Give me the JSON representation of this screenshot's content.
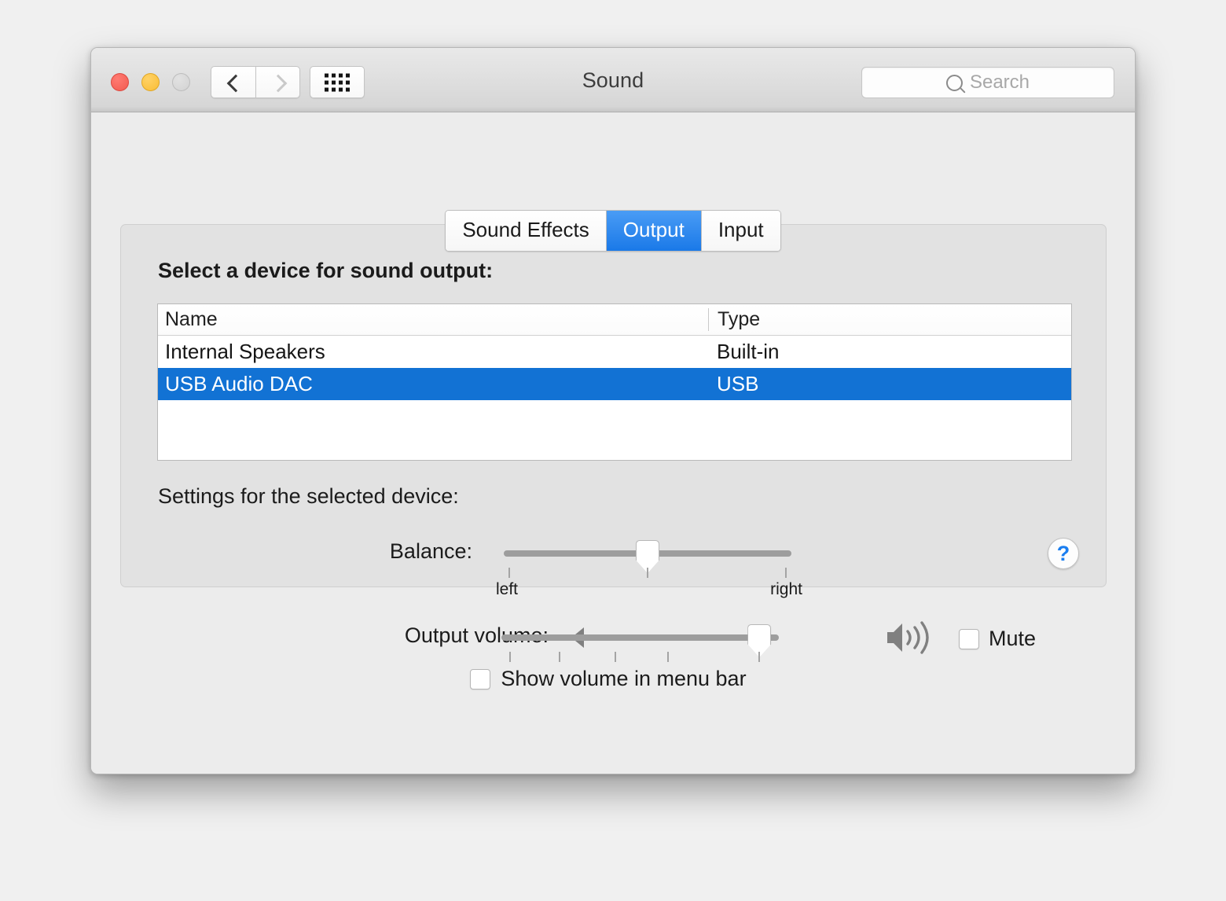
{
  "window": {
    "title": "Sound",
    "traffic_lights": [
      "close",
      "minimize",
      "zoom"
    ],
    "nav": {
      "back": "back",
      "forward": "forward",
      "show_all": "show-all"
    },
    "search": {
      "placeholder": "Search",
      "value": ""
    }
  },
  "tabs": [
    {
      "label": "Sound Effects",
      "active": false
    },
    {
      "label": "Output",
      "active": true
    },
    {
      "label": "Input",
      "active": false
    }
  ],
  "panel": {
    "select_device_label": "Select a device for sound output:",
    "settings_label": "Settings for the selected device:",
    "help_label": "?"
  },
  "device_table": {
    "columns": [
      "Name",
      "Type"
    ],
    "rows": [
      {
        "name": "Internal Speakers",
        "type": "Built-in",
        "selected": false
      },
      {
        "name": "USB Audio DAC",
        "type": "USB",
        "selected": true
      }
    ]
  },
  "balance": {
    "label": "Balance:",
    "min_label": "left",
    "max_label": "right",
    "value_percent": 50,
    "tick_percents": [
      2,
      50,
      98
    ]
  },
  "output_volume": {
    "label": "Output volume:",
    "value_percent": 93,
    "tick_percents": [
      3,
      21,
      41,
      60,
      93
    ],
    "low_icon": "speaker-low-icon",
    "high_icon": "speaker-high-icon"
  },
  "mute": {
    "label": "Mute",
    "checked": false
  },
  "show_volume_menu_bar": {
    "label": "Show volume in menu bar",
    "checked": false
  },
  "colors": {
    "accent_blue": "#1272d4",
    "tab_active_blue": "#1a79e8",
    "help_blue": "#1a7ef0",
    "window_bg": "#ececec",
    "panel_bg": "#e2e2e2"
  }
}
